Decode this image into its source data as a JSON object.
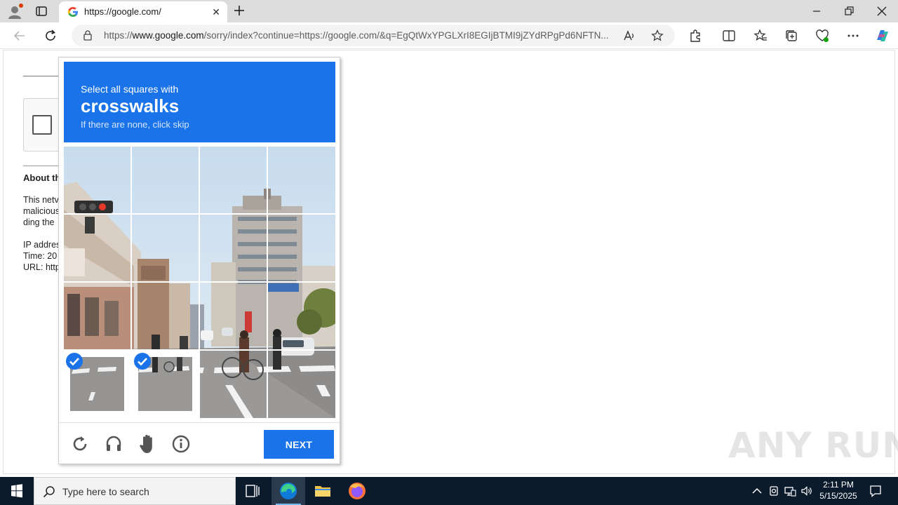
{
  "browser": {
    "tab_title": "https://google.com/",
    "url_prefix": "https://",
    "url_domain": "www.google.com",
    "url_rest": "/sorry/index?continue=https://google.com/&q=EgQtWxYPGLXrI8EGIjBTMI9jZYdRPgPd6NFTN..."
  },
  "background_page": {
    "about_heading": "About th",
    "lines": [
      "This netv",
      "malicious",
      "ding the",
      "IP addres",
      "Time: 20",
      "URL: http"
    ]
  },
  "captcha": {
    "instruction": "Select all squares with",
    "target": "crosswalks",
    "hint": "If there are none, click skip",
    "next_label": "NEXT",
    "selected_tiles": [
      12,
      13
    ],
    "colors": {
      "header": "#1a73e8",
      "button": "#1a73e8"
    }
  },
  "watermark": "ANY RUN",
  "taskbar": {
    "search_placeholder": "Type here to search",
    "time": "2:11 PM",
    "date": "5/15/2025"
  }
}
